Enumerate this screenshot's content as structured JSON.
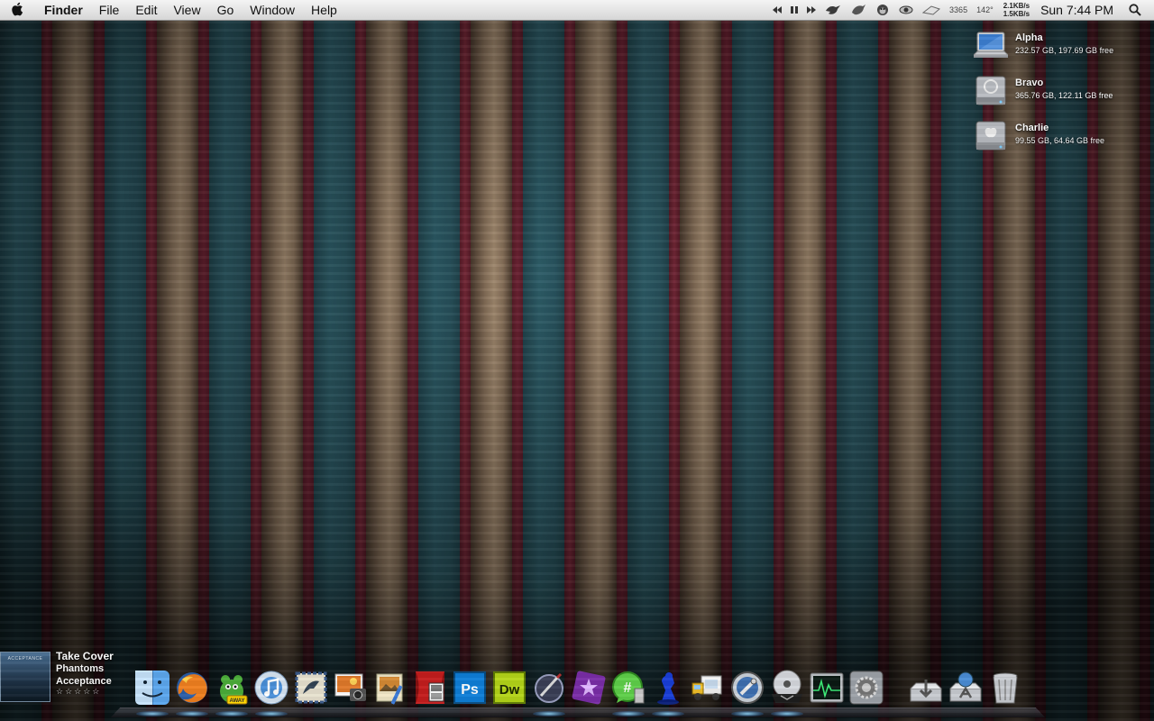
{
  "menubar": {
    "app_name": "Finder",
    "menus": [
      "File",
      "Edit",
      "View",
      "Go",
      "Window",
      "Help"
    ],
    "status_counter": "3365",
    "status_temp": "142°",
    "net_up": "2.1KB/s",
    "net_down": "1.5KB/s",
    "clock": "Sun 7:44 PM",
    "icons": [
      "apple-icon",
      "prev-track-icon",
      "pause-icon",
      "next-track-icon",
      "bird-icon",
      "bird-icon",
      "monkey-icon",
      "eye-icon",
      "hat-icon",
      "search-icon"
    ]
  },
  "drives": [
    {
      "name": "Alpha",
      "info": "232.57 GB, 197.69 GB free",
      "icon": "laptop-drive-icon"
    },
    {
      "name": "Bravo",
      "info": "365.76 GB, 122.11 GB free",
      "icon": "hard-drive-icon"
    },
    {
      "name": "Charlie",
      "info": "99.55 GB, 64.64 GB free",
      "icon": "hard-drive-icon"
    }
  ],
  "now_playing": {
    "cover_label": "ACCEPTANCE",
    "title": "Take Cover",
    "artist": "Phantoms",
    "album": "Acceptance",
    "stars": "☆☆☆☆☆"
  },
  "dock": {
    "items": [
      {
        "name": "finder-icon",
        "running": true
      },
      {
        "name": "firefox-icon",
        "running": true
      },
      {
        "name": "adium-icon",
        "running": true,
        "badge": "AWAY"
      },
      {
        "name": "itunes-icon",
        "running": true
      },
      {
        "name": "mail-icon",
        "running": false
      },
      {
        "name": "image-capture-icon",
        "running": false
      },
      {
        "name": "preview-icon",
        "running": false
      },
      {
        "name": "photo-booth-icon",
        "running": false
      },
      {
        "name": "photoshop-icon",
        "running": false,
        "label": "Ps"
      },
      {
        "name": "dreamweaver-icon",
        "running": false,
        "label": "Dw"
      },
      {
        "name": "script-editor-icon",
        "running": true
      },
      {
        "name": "starlight-icon",
        "running": false
      },
      {
        "name": "chat-icon",
        "running": true
      },
      {
        "name": "blue-figure-icon",
        "running": true
      },
      {
        "name": "transmit-truck-icon",
        "running": false
      },
      {
        "name": "network-utility-icon",
        "running": true
      },
      {
        "name": "dvd-player-icon",
        "running": true
      },
      {
        "name": "activity-monitor-icon",
        "running": false
      },
      {
        "name": "system-preferences-icon",
        "running": false
      },
      {
        "name": "downloads-stack-icon",
        "running": false
      },
      {
        "name": "applications-stack-icon",
        "running": false
      },
      {
        "name": "trash-icon",
        "running": false
      }
    ]
  }
}
